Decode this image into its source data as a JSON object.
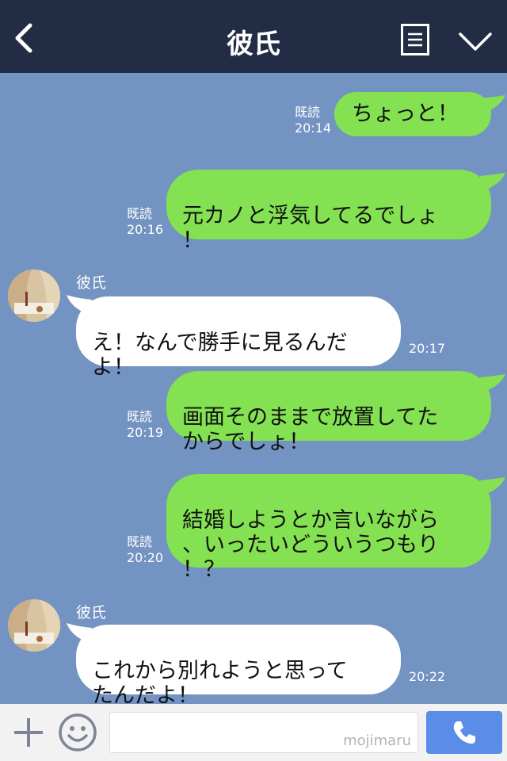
{
  "header": {
    "title": "彼氏",
    "back_icon": "chevron-left-icon",
    "menu_icon": "list-icon",
    "dropdown_icon": "chevron-down-icon"
  },
  "messages": [
    {
      "side": "out",
      "text": "ちょっと！",
      "read": "既読",
      "time": "20:14"
    },
    {
      "side": "out",
      "text": "元カノと浮気してるでしょ\n！",
      "read": "既読",
      "time": "20:16"
    },
    {
      "side": "in",
      "sender": "彼氏",
      "text": "え！なんで勝手に見るんだ\nよ！",
      "time": "20:17"
    },
    {
      "side": "out",
      "text": "画面そのままで放置してた\nからでしょ！",
      "read": "既読",
      "time": "20:19"
    },
    {
      "side": "out",
      "text": "結婚しようとか言いながら\n、いったいどういうつもり\n！？",
      "read": "既読",
      "time": "20:20"
    },
    {
      "side": "in",
      "sender": "彼氏",
      "text": "これから別れようと思って\nたんだよ！",
      "time": "20:22"
    }
  ],
  "input_bar": {
    "plus_icon": "plus-icon",
    "emoji_icon": "smile-icon",
    "watermark": "mojimaru",
    "call_icon": "phone-icon"
  },
  "colors": {
    "header": "#232c45",
    "background": "#7393c2",
    "outgoing": "#84e152",
    "incoming": "#ffffff",
    "call_button": "#5b8de8"
  }
}
